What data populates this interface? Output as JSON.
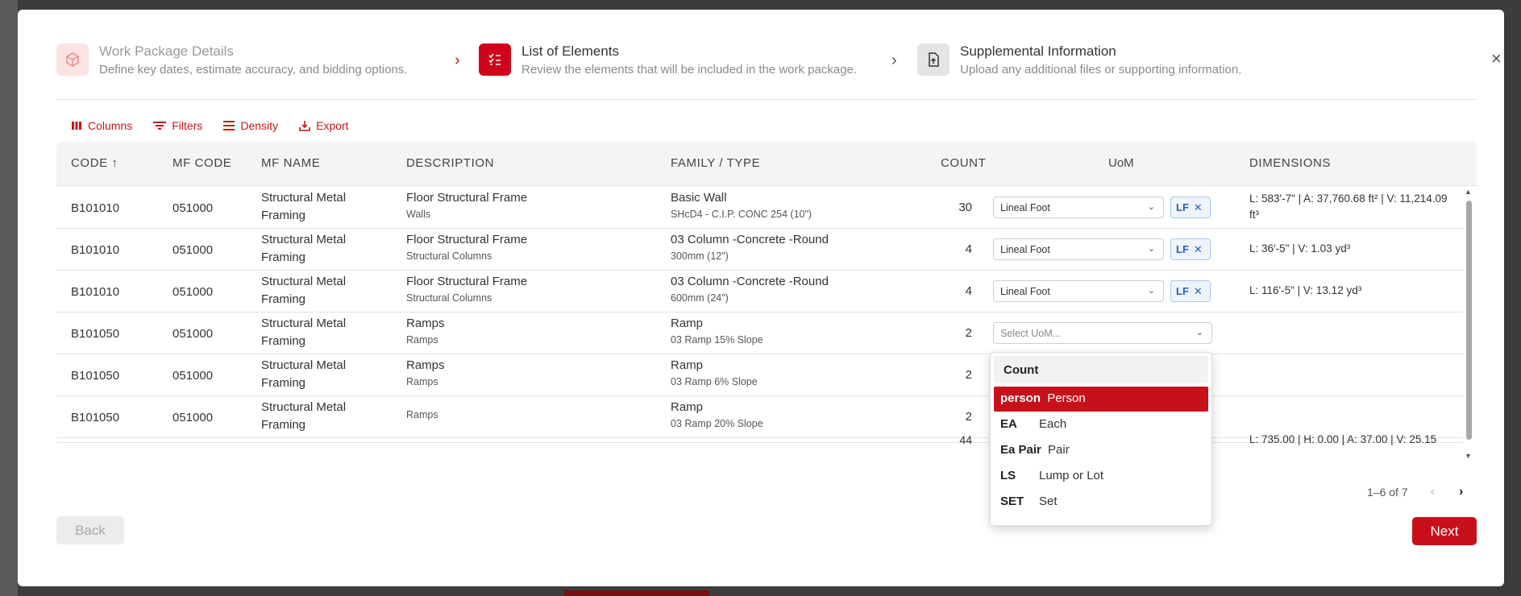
{
  "stepper": {
    "steps": [
      {
        "title": "Work Package Details",
        "subtitle": "Define key dates, estimate accuracy, and bidding options."
      },
      {
        "title": "List of Elements",
        "subtitle": "Review the elements that will be included in the work package."
      },
      {
        "title": "Supplemental Information",
        "subtitle": "Upload any additional files or supporting information."
      }
    ],
    "close": "×"
  },
  "toolbar": {
    "columns": "Columns",
    "filters": "Filters",
    "density": "Density",
    "export": "Export"
  },
  "table": {
    "headers": {
      "code": "CODE ↑",
      "mf_code": "MF CODE",
      "mf_name": "MF NAME",
      "description": "DESCRIPTION",
      "family_type": "FAMILY / TYPE",
      "count": "COUNT",
      "uom": "UoM",
      "dimensions": "DIMENSIONS"
    },
    "rows": [
      {
        "code": "B101010",
        "mf_code": "051000",
        "mf_name_1": "Structural Metal",
        "mf_name_2": "Framing",
        "desc_1": "Floor Structural Frame",
        "desc_2": "Walls",
        "fam_1": "Basic Wall",
        "fam_2": "SHcD4 - C.I.P. CONC 254 (10\")",
        "count": "30",
        "uom": "Lineal Foot",
        "tag": "LF",
        "dims": "L: 583'-7\" | A: 37,760.68 ft² | V: 11,214.09 ft³"
      },
      {
        "code": "B101010",
        "mf_code": "051000",
        "mf_name_1": "Structural Metal",
        "mf_name_2": "Framing",
        "desc_1": "Floor Structural Frame",
        "desc_2": "Structural Columns",
        "fam_1": "03 Column -Concrete -Round",
        "fam_2": "300mm (12\")",
        "count": "4",
        "uom": "Lineal Foot",
        "tag": "LF",
        "dims": "L: 36'-5\" | V: 1.03 yd³"
      },
      {
        "code": "B101010",
        "mf_code": "051000",
        "mf_name_1": "Structural Metal",
        "mf_name_2": "Framing",
        "desc_1": "Floor Structural Frame",
        "desc_2": "Structural Columns",
        "fam_1": "03 Column -Concrete -Round",
        "fam_2": "600mm (24\")",
        "count": "4",
        "uom": "Lineal Foot",
        "tag": "LF",
        "dims": "L: 116'-5\" | V: 13.12 yd³"
      },
      {
        "code": "B101050",
        "mf_code": "051000",
        "mf_name_1": "Structural Metal",
        "mf_name_2": "Framing",
        "desc_1": "Ramps",
        "desc_2": "Ramps",
        "fam_1": "Ramp",
        "fam_2": "03 Ramp 15% Slope",
        "count": "2",
        "uom_placeholder": "Select UoM..."
      },
      {
        "code": "B101050",
        "mf_code": "051000",
        "mf_name_1": "Structural Metal",
        "mf_name_2": "Framing",
        "desc_1": "Ramps",
        "desc_2": "Ramps",
        "fam_1": "Ramp",
        "fam_2": "03 Ramp 6% Slope",
        "count": "2"
      },
      {
        "code": "B101050",
        "mf_code": "051000",
        "mf_name_1": "Structural Metal",
        "mf_name_2": "Framing",
        "desc_1": "",
        "desc_2": "Ramps",
        "fam_1": "Ramp",
        "fam_2": "03 Ramp 20% Slope",
        "count": "2"
      }
    ],
    "summary": {
      "count": "44",
      "dims": "L: 735.00 | H: 0.00 | A: 37.00 | V: 25.15"
    }
  },
  "pagination": {
    "label": "1–6 of 7",
    "prev": "‹",
    "next": "›"
  },
  "footer": {
    "back": "Back",
    "next": "Next"
  },
  "uom_dropdown": {
    "group": "Count",
    "items": [
      {
        "code": "person",
        "label": "Person",
        "selected": true
      },
      {
        "code": "EA",
        "label": "Each"
      },
      {
        "code": "Ea Pair",
        "label": "Pair"
      },
      {
        "code": "LS",
        "label": "Lump or Lot"
      },
      {
        "code": "SET",
        "label": "Set"
      }
    ]
  },
  "colors": {
    "accent": "#c8101a",
    "tag_blue": "#2a5fb0"
  }
}
